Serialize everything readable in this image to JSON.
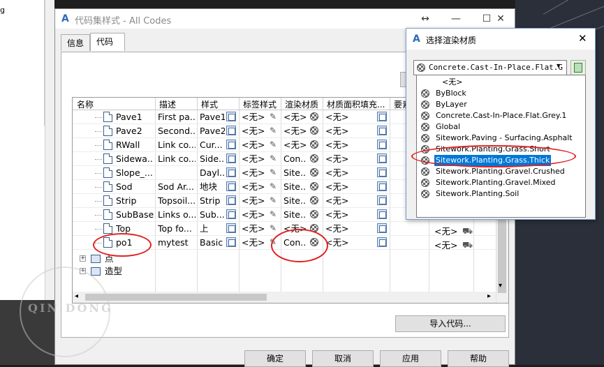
{
  "background": {
    "left_text": "g"
  },
  "main_dialog": {
    "title": "代码集样式 - All Codes",
    "icon": "autocad-a-icon",
    "tabs": [
      {
        "label": "信息"
      },
      {
        "label": "代码"
      }
    ],
    "grid": {
      "columns": [
        "名称",
        "描述",
        "样式",
        "标签样式",
        "渲染材质",
        "材质面积填充...",
        "要素"
      ],
      "rows": [
        {
          "name": "Pave1",
          "description": "First pa...",
          "style": "Pave1",
          "label_style": "<无>",
          "render_material": "<无>",
          "area_fill": "<无>"
        },
        {
          "name": "Pave2",
          "description": "Second...",
          "style": "Pave2",
          "label_style": "<无>",
          "render_material": "<无>",
          "area_fill": "<无>"
        },
        {
          "name": "RWall",
          "description": "Link co...",
          "style": "Cur...",
          "label_style": "<无>",
          "render_material": "<无>",
          "area_fill": "<无>"
        },
        {
          "name": "Sidewa...",
          "description": "Link co...",
          "style": "Side...",
          "label_style": "<无>",
          "render_material": "Con...",
          "area_fill": "<无>"
        },
        {
          "name": "Slope_...",
          "description": "",
          "style": "Dayl...",
          "label_style": "<无>",
          "render_material": "Site...",
          "area_fill": "<无>"
        },
        {
          "name": "Sod",
          "description": "Sod Ar...",
          "style": "地块",
          "label_style": "<无>",
          "render_material": "Site...",
          "area_fill": "<无>"
        },
        {
          "name": "Strip",
          "description": "Topsoil...",
          "style": "Strip",
          "label_style": "<无>",
          "render_material": "Site...",
          "area_fill": "<无>"
        },
        {
          "name": "SubBase",
          "description": "Links o...",
          "style": "Sub...",
          "label_style": "<无>",
          "render_material": "Site...",
          "area_fill": "<无>"
        },
        {
          "name": "Top",
          "description": "Top fo...",
          "style": "上",
          "label_style": "<无>",
          "render_material": "<无>",
          "area_fill": "<无>"
        },
        {
          "name": "po1",
          "description": "mytest",
          "style": "Basic",
          "label_style": "<无>",
          "render_material": "Con...",
          "area_fill": "<无>"
        }
      ],
      "right_cells": [
        "<无>",
        "<无>"
      ],
      "tree_nodes": [
        {
          "label": "点"
        },
        {
          "label": "造型"
        }
      ]
    },
    "import_button": "导入代码...",
    "buttons": {
      "ok": "确定",
      "cancel": "取消",
      "apply": "应用",
      "help": "帮助"
    }
  },
  "popup": {
    "title": "选择渲染材质",
    "combo_value": "Concrete.Cast-In-Place.Flat.G",
    "options": [
      "<无>",
      "ByBlock",
      "ByLayer",
      "Concrete.Cast-In-Place.Flat.Grey.1",
      "Global",
      "Sitework.Paving - Surfacing.Asphalt",
      "Sitework.Planting.Grass.Short",
      "Sitework.Planting.Grass.Thick",
      "Sitework.Planting.Gravel.Crushed",
      "Sitework.Planting.Gravel.Mixed",
      "Sitework.Planting.Soil"
    ],
    "selected_option": "Sitework.Planting.Grass.Thick"
  },
  "watermark": {
    "text": "QIN DONG"
  },
  "colors": {
    "highlight": "#0078d7",
    "annotation": "#e02020",
    "autocad_icon": "#2d6bbd"
  }
}
